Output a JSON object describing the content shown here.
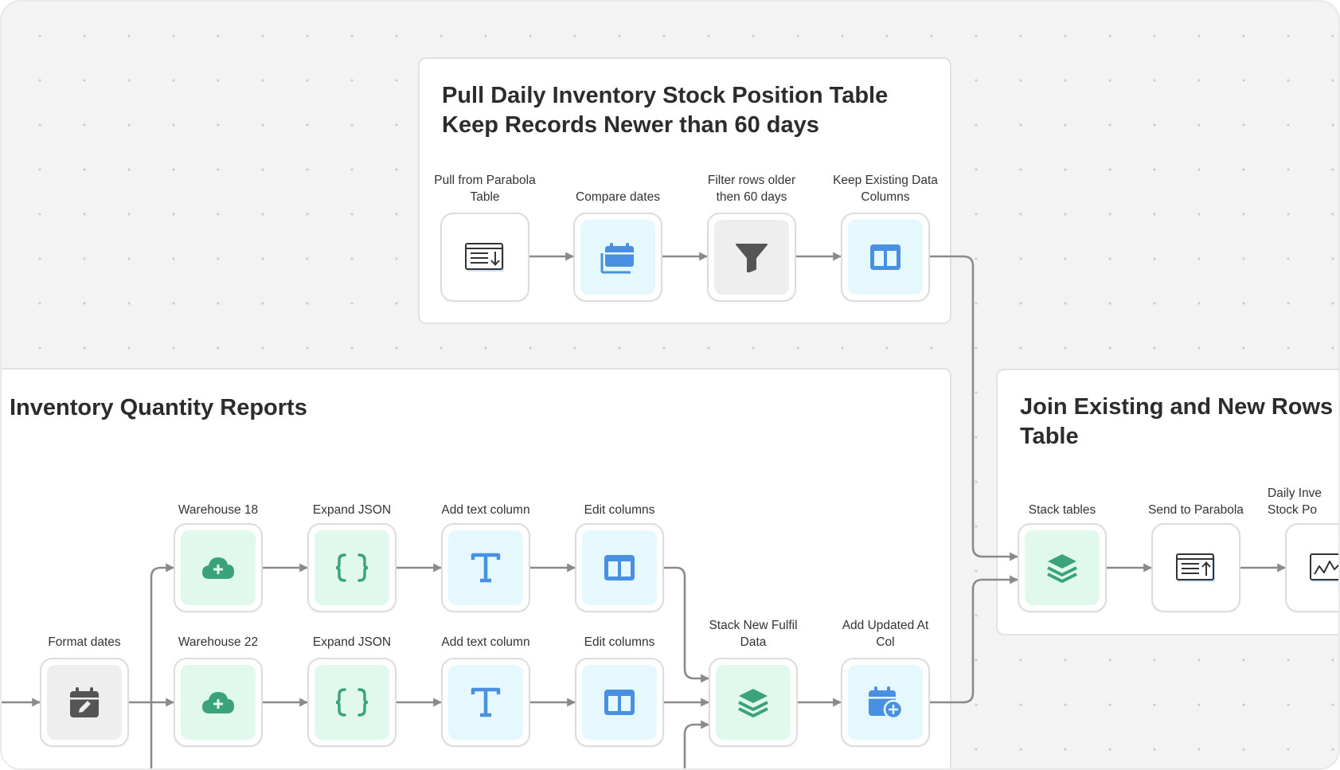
{
  "groups": {
    "pull_daily": {
      "title": "Pull Daily Inventory Stock Position Table\nKeep Records Newer than 60 days"
    },
    "inventory_reports": {
      "title": "Inventory Quantity Reports"
    },
    "join_existing": {
      "title": "Join Existing and New Rows an\nTable"
    }
  },
  "nodes": {
    "pull_from_parabola": {
      "label": "Pull from Parabola\nTable",
      "icon": "table-download-icon"
    },
    "compare_dates": {
      "label": "Compare dates",
      "icon": "calendar-stack-icon"
    },
    "filter_rows": {
      "label": "Filter rows older\nthen 60 days",
      "icon": "funnel-icon"
    },
    "keep_existing": {
      "label": "Keep Existing Data\nColumns",
      "icon": "columns-icon"
    },
    "format_dates": {
      "label": "Format dates",
      "icon": "calendar-edit-icon"
    },
    "warehouse_18": {
      "label": "Warehouse 18",
      "icon": "cloud-plus-icon"
    },
    "expand_json_1": {
      "label": "Expand JSON",
      "icon": "curly-braces-icon"
    },
    "add_text_1": {
      "label": "Add text column",
      "icon": "text-t-icon"
    },
    "edit_columns_1": {
      "label": "Edit columns",
      "icon": "columns-icon"
    },
    "warehouse_22": {
      "label": "Warehouse 22",
      "icon": "cloud-plus-icon"
    },
    "expand_json_2": {
      "label": "Expand JSON",
      "icon": "curly-braces-icon"
    },
    "add_text_2": {
      "label": "Add text column",
      "icon": "text-t-icon"
    },
    "edit_columns_2": {
      "label": "Edit columns",
      "icon": "columns-icon"
    },
    "stack_new_fulfil": {
      "label": "Stack New Fulfil\nData",
      "icon": "layers-icon"
    },
    "add_updated_at": {
      "label": "Add Updated At\nCol",
      "icon": "calendar-plus-icon"
    },
    "stack_tables": {
      "label": "Stack tables",
      "icon": "layers-icon"
    },
    "send_to_parabola": {
      "label": "Send to Parabola",
      "icon": "table-upload-icon"
    },
    "daily_inventory": {
      "label": "Daily Inve\nStock Po",
      "icon": "chart-line-icon"
    }
  },
  "colors": {
    "blue_icon": "#4a90e2",
    "green_icon": "#3aa37c",
    "gray_icon": "#555555",
    "wire": "#8a8a8a",
    "canvas": "#f3f3f3"
  }
}
